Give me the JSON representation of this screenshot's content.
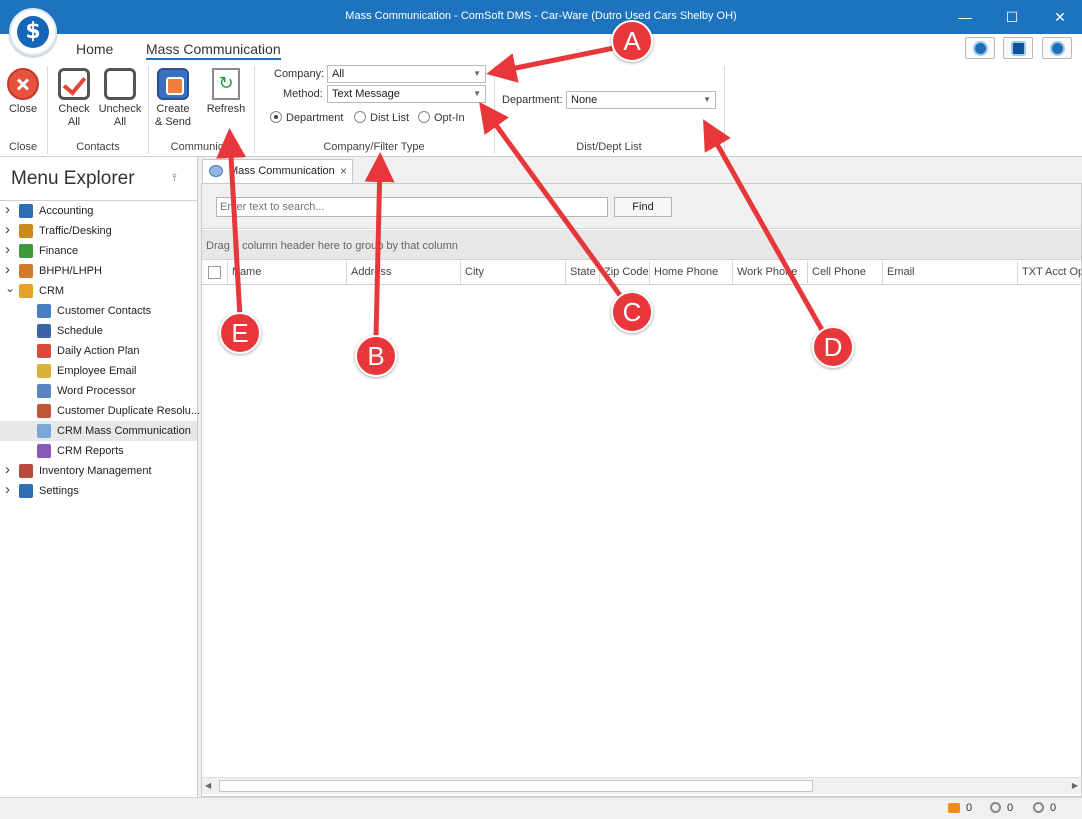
{
  "window": {
    "title": "Mass Communication - ComSoft DMS - Car-Ware (Dutro Used Cars Shelby OH)",
    "minimize": "—",
    "maximize": "☐",
    "close": "✕",
    "logo_glyph": "$"
  },
  "ribbon": {
    "tabs": [
      "Home",
      "Mass Communication"
    ],
    "active_tab": "Mass Communication",
    "buttons": {
      "close": [
        "Close"
      ],
      "check_all": [
        "Check",
        "All"
      ],
      "uncheck_all": [
        "Uncheck",
        "All"
      ],
      "create_send": [
        "Create",
        "& Send"
      ],
      "refresh": [
        "Refresh"
      ],
      "refresh_glyph": "↻"
    },
    "groups": {
      "close": "Close",
      "contacts": "Contacts",
      "communication": "Communica",
      "company_filter": "Company/Filter Type",
      "dist_dept": "Dist/Dept List"
    },
    "company_label": "Company:",
    "company_value": "All",
    "method_label": "Method:",
    "method_value": "Text Message",
    "radios": {
      "department": "Department",
      "dist_list": "Dist List",
      "opt_in": "Opt-In",
      "selected": "Department"
    },
    "department_label": "Department:",
    "department_value": "None"
  },
  "menu_explorer": {
    "title": "Menu Explorer",
    "pin_glyph": "⫯",
    "items": [
      {
        "label": "Accounting",
        "icon": "calculator-icon",
        "color": "#2f6db5",
        "expanded": false
      },
      {
        "label": "Traffic/Desking",
        "icon": "signpost-icon",
        "color": "#c98a1a",
        "expanded": false
      },
      {
        "label": "Finance",
        "icon": "finance-icon",
        "color": "#3d9a3a",
        "expanded": false
      },
      {
        "label": "BHPH/LHPH",
        "icon": "handshake-icon",
        "color": "#d27a2c",
        "expanded": false
      },
      {
        "label": "CRM",
        "icon": "folder-icon",
        "color": "#e3a32a",
        "expanded": true
      }
    ],
    "crm_children": [
      {
        "label": "Customer Contacts",
        "icon": "contacts-icon",
        "color": "#4a7ec2"
      },
      {
        "label": "Schedule",
        "icon": "calendar-icon",
        "color": "#3a64a8"
      },
      {
        "label": "Daily Action Plan",
        "icon": "checkmark-icon",
        "color": "#d94a3a"
      },
      {
        "label": "Employee Email",
        "icon": "email-icon",
        "color": "#d9b23a"
      },
      {
        "label": "Word Processor",
        "icon": "document-icon",
        "color": "#5a84c0"
      },
      {
        "label": "Customer Duplicate Resolu...",
        "icon": "people-icon",
        "color": "#c0563a"
      },
      {
        "label": "CRM Mass Communication",
        "icon": "satellite-icon",
        "color": "#7aa6d8",
        "selected": true
      },
      {
        "label": "CRM Reports",
        "icon": "reports-icon",
        "color": "#8a5ab8"
      }
    ],
    "bottom_items": [
      {
        "label": "Inventory Management",
        "icon": "car-icon",
        "color": "#b84a3a",
        "expanded": false
      },
      {
        "label": "Settings",
        "icon": "settings-icon",
        "color": "#2f6db5",
        "expanded": false
      }
    ]
  },
  "document": {
    "tab_label": "Mass Communication",
    "tab_close": "×",
    "search_placeholder": "Enter text to search...",
    "find_label": "Find",
    "group_panel_text": "Drag a column header here to group by that column",
    "columns": [
      "Name",
      "Address",
      "City",
      "State",
      "Zip Code",
      "Home Phone",
      "Work Phone",
      "Cell Phone",
      "Email",
      "TXT Acct Opt"
    ]
  },
  "statusbar": {
    "messages": "0",
    "blocked1": "0",
    "blocked2": "0"
  },
  "annotations": [
    "A",
    "B",
    "C",
    "D",
    "E"
  ],
  "colors": {
    "title_bar": "#1e73be",
    "annotation": "#e8373b"
  }
}
